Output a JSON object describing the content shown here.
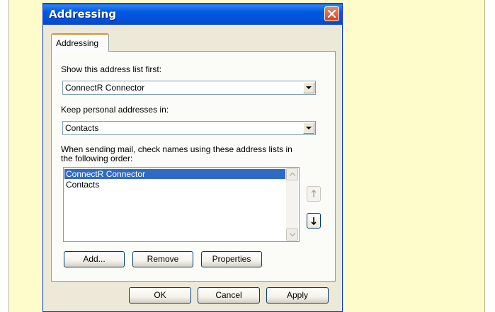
{
  "dialog": {
    "title": "Addressing",
    "tab_label": "Addressing"
  },
  "show_first": {
    "label": "Show this address list first:",
    "value": "ConnectR Connector"
  },
  "keep_personal": {
    "label": "Keep personal addresses in:",
    "value": "Contacts"
  },
  "check_names": {
    "label_line1": "When sending mail, check names using these address lists in",
    "label_line2": "the following order:",
    "items": [
      {
        "label": "ConnectR Connector",
        "selected": true
      },
      {
        "label": "Contacts",
        "selected": false
      }
    ]
  },
  "list_buttons": {
    "add": "Add...",
    "remove": "Remove",
    "properties": "Properties"
  },
  "footer_buttons": {
    "ok": "OK",
    "cancel": "Cancel",
    "apply": "Apply"
  },
  "colors": {
    "titlebar": "#0054dc",
    "selection": "#316ac5",
    "panel_background": "#fffccc",
    "dialog_face": "#ece9d8"
  },
  "icons": {
    "close": "close-icon",
    "dropdown": "chevron-down-icon",
    "move_up": "arrow-up-icon",
    "move_down": "arrow-down-icon"
  }
}
